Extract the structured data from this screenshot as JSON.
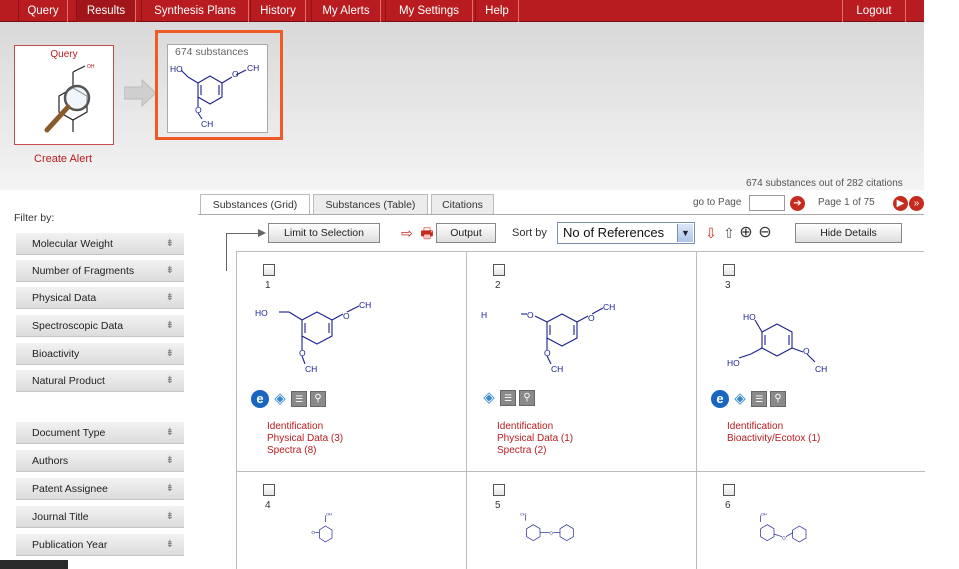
{
  "nav": {
    "items": [
      {
        "label": "Query",
        "active": false
      },
      {
        "label": "Results",
        "active": true
      },
      {
        "label": "Synthesis Plans",
        "active": false
      },
      {
        "label": "History",
        "active": false
      },
      {
        "label": "My Alerts",
        "active": false
      },
      {
        "label": "My Settings",
        "active": false
      },
      {
        "label": "Help",
        "active": false
      }
    ],
    "logout": "Logout"
  },
  "header": {
    "query_label": "Query",
    "result_count": "674 substances",
    "create_alert": "Create Alert"
  },
  "summary": "674 substances out of 282 citations",
  "tabs": [
    {
      "label": "Substances (Grid)",
      "active": true
    },
    {
      "label": "Substances (Table)",
      "active": false
    },
    {
      "label": "Citations",
      "active": false
    }
  ],
  "pagination": {
    "goto_label": "go to Page",
    "goto_value": "",
    "page_info": "Page 1 of 75"
  },
  "toolbar": {
    "limit_button": "Limit to Selection",
    "output_button": "Output",
    "sort_label": "Sort by",
    "sort_value": "No of References",
    "hide_details": "Hide Details"
  },
  "filters": {
    "title": "Filter by:",
    "group1": [
      "Molecular Weight",
      "Number of Fragments",
      "Physical Data",
      "Spectroscopic Data",
      "Bioactivity",
      "Natural Product"
    ],
    "group2": [
      "Document Type",
      "Authors",
      "Patent Assignee",
      "Journal Title",
      "Publication Year"
    ]
  },
  "results": [
    {
      "number": "1",
      "links": [
        "Identification",
        "Physical Data (3)",
        "Spectra (8)"
      ]
    },
    {
      "number": "2",
      "links": [
        "Identification",
        "Physical Data (1)",
        "Spectra (2)"
      ]
    },
    {
      "number": "3",
      "links": [
        "Identification",
        "Bioactivity/Ecotox (1)"
      ]
    },
    {
      "number": "4",
      "links": []
    },
    {
      "number": "5",
      "links": []
    },
    {
      "number": "6",
      "links": []
    }
  ],
  "structure_labels": {
    "ho": "HO",
    "ch3": "CH",
    "o": "O",
    "h2n": "H",
    "oh": "OH"
  },
  "colors": {
    "brand_red": "#b81c20",
    "highlight_orange": "#f05a28",
    "structure_blue": "#1a1f8f"
  }
}
